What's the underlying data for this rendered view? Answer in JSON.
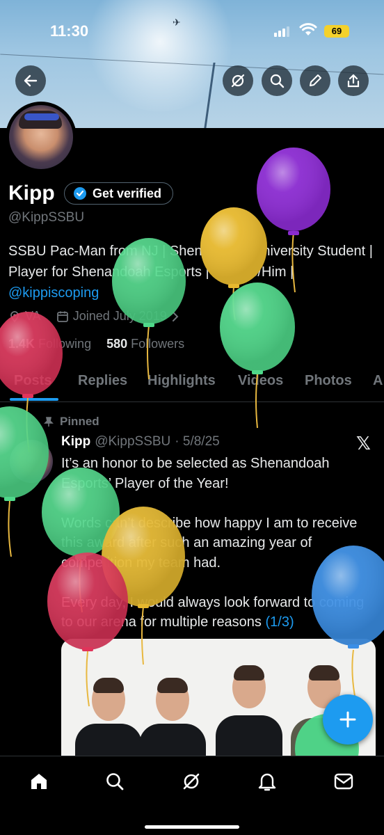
{
  "status_bar": {
    "time": "11:30",
    "battery": "69"
  },
  "profile": {
    "name": "Kipp",
    "get_verified": "Get verified",
    "handle": "@KippSSBU",
    "bio_text": "SSBU Pac-Man from NJ | Shenandoah University Student | Player for Shenandoah Esports | 21 | He/Him | ",
    "bio_link": "@kippiscoping",
    "location": "VA",
    "joined": "Joined July 2019",
    "following_count": "1.4K",
    "following_label": "Following",
    "followers_count": "580",
    "followers_label": "Followers"
  },
  "tabs": [
    "Posts",
    "Replies",
    "Highlights",
    "Videos",
    "Photos",
    "A"
  ],
  "post": {
    "pinned_label": "Pinned",
    "author_name": "Kipp",
    "author_handle": "@KippSSBU",
    "date": "· 5/8/25",
    "paragraph_1": "It’s an honor to be selected as Shenandoah Esports’ Player of the Year!",
    "paragraph_2": "Words can’t describe how happy I am to receive this award after such an amazing year of competition my team had.",
    "paragraph_3": "Every day, I would always look forward to coming to our arena for multiple reasons",
    "thread_count": "(1/3)"
  },
  "colors": {
    "accent": "#1d9bf0",
    "background": "#000000",
    "balloon_purple": "#8a2bd0",
    "balloon_yellow": "#e6b82e",
    "balloon_green": "#4fd98a",
    "balloon_red": "#e0345a",
    "balloon_blue": "#3a8ee6"
  },
  "icons": {
    "back": "arrow-left-icon",
    "grok": "grok-icon",
    "search": "search-icon",
    "edit": "pencil-icon",
    "share": "share-icon",
    "home": "home-icon",
    "notifications": "bell-icon",
    "messages": "mail-icon",
    "compose": "plus-icon"
  }
}
